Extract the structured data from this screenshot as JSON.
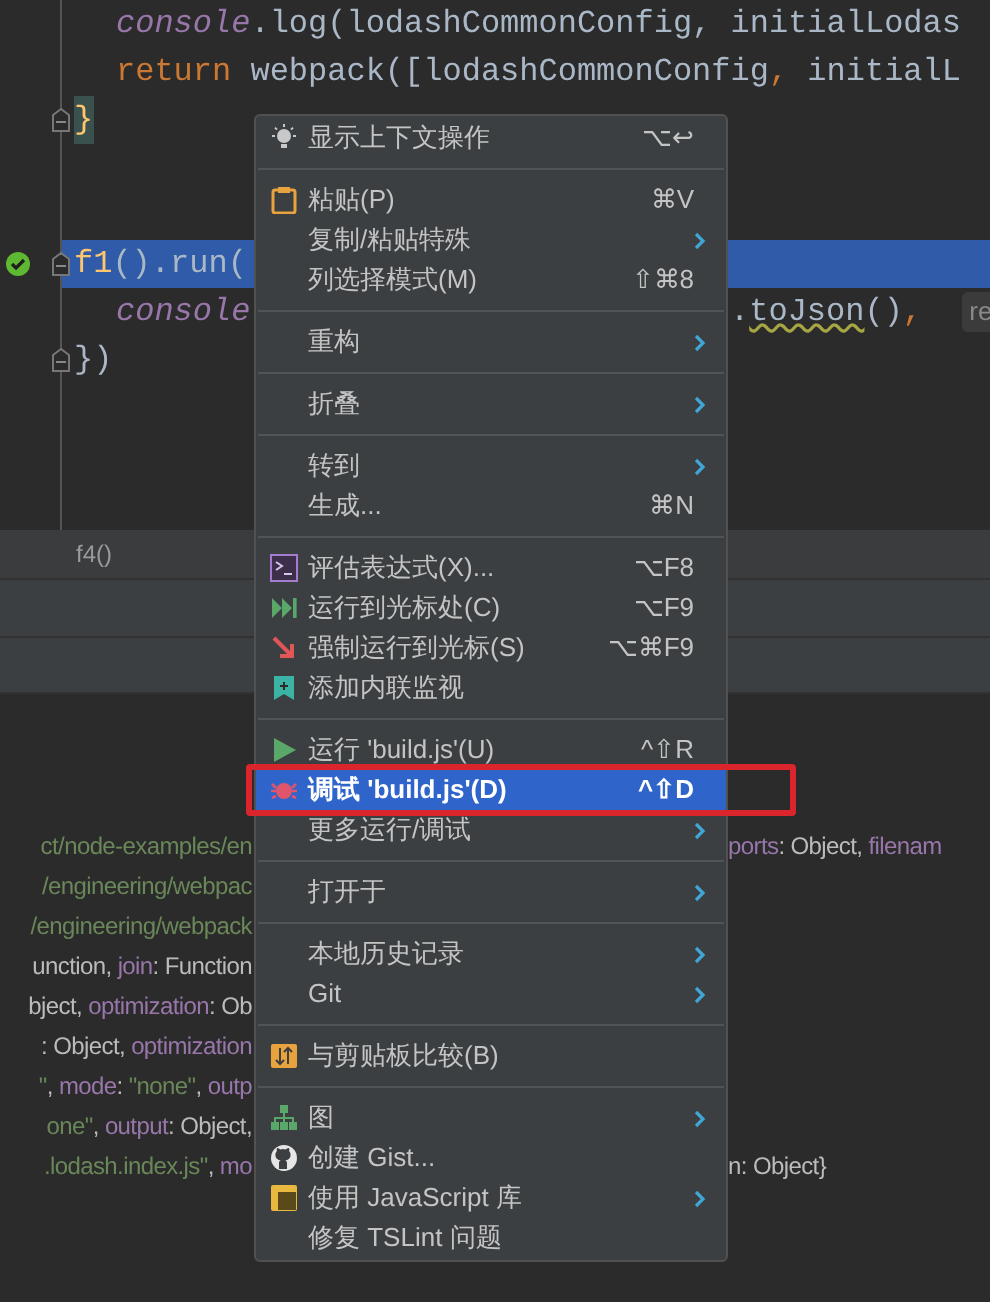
{
  "editor": {
    "lines": [
      {
        "kind": "code",
        "left": [
          {
            "text": "console",
            "kind": "field"
          },
          {
            "text": ".log(lodashCommonConfig, initialLodas",
            "kind": "plain"
          }
        ],
        "indented": true,
        "highlighted": false
      },
      {
        "kind": "code",
        "left": [
          {
            "text": "return ",
            "kind": "keyword"
          },
          {
            "text": "webpack([lodashCommonConfig",
            "kind": "plain"
          },
          {
            "text": ", ",
            "kind": "keyword"
          },
          {
            "text": "initialL",
            "kind": "plain"
          }
        ],
        "indented": true,
        "highlighted": false
      },
      {
        "kind": "code",
        "left": [
          {
            "text": "}",
            "kind": "brace"
          }
        ],
        "gutter": [
          {
            "kind": "fold"
          }
        ],
        "indented": false,
        "highlighted": false
      },
      {
        "kind": "blank"
      },
      {
        "kind": "blank"
      },
      {
        "kind": "code",
        "left": [
          {
            "text": "f1",
            "kind": "function"
          },
          {
            "text": "().run(",
            "kind": "plain"
          }
        ],
        "gutter": [
          {
            "kind": "check"
          },
          {
            "kind": "fold"
          }
        ],
        "indented": false,
        "highlighted": true
      },
      {
        "kind": "code",
        "left": [
          {
            "text": "console",
            "kind": "field"
          }
        ],
        "right": [
          {
            "text": ".",
            "kind": "plain"
          },
          {
            "text": "toJson",
            "kind": "warning"
          },
          {
            "text": "()",
            "kind": "plain"
          },
          {
            "text": ", ",
            "kind": "keyword"
          },
          {
            "text": "re",
            "kind": "hint"
          }
        ],
        "indented": true,
        "highlighted": false
      },
      {
        "kind": "code",
        "left": [
          {
            "text": "})",
            "kind": "plain"
          }
        ],
        "gutter": [
          {
            "kind": "fold"
          }
        ],
        "indented": false,
        "highlighted": false
      }
    ]
  },
  "breadcrumb": "f4()",
  "console_lines": [
    {
      "left": [
        {
          "text": "ct/node-examples/en",
          "kind": "string"
        }
      ],
      "right": [
        {
          "text": "ports",
          "kind": "key"
        },
        {
          "text": ": Object, ",
          "kind": "plain"
        },
        {
          "text": "filenam",
          "kind": "key"
        }
      ]
    },
    {
      "left": [
        {
          "text": "/engineering/webpac",
          "kind": "string"
        }
      ]
    },
    {
      "left": [
        {
          "text": "/engineering/webpack",
          "kind": "string"
        }
      ]
    },
    {
      "left": [
        {
          "text": "unction, ",
          "kind": "plain"
        },
        {
          "text": "join",
          "kind": "key"
        },
        {
          "text": ": Function",
          "kind": "plain"
        }
      ]
    },
    {
      "left": [
        {
          "text": "bject, ",
          "kind": "plain"
        },
        {
          "text": "optimization",
          "kind": "key"
        },
        {
          "text": ": Ob",
          "kind": "plain"
        }
      ]
    },
    {
      "left": [
        {
          "text": ": Object, ",
          "kind": "plain"
        },
        {
          "text": "optimization",
          "kind": "key"
        }
      ]
    },
    {
      "left": [
        {
          "text": "\"",
          "kind": "string"
        },
        {
          "text": ", ",
          "kind": "plain"
        },
        {
          "text": "mode",
          "kind": "key"
        },
        {
          "text": ": ",
          "kind": "plain"
        },
        {
          "text": "\"none\"",
          "kind": "string"
        },
        {
          "text": ", ",
          "kind": "plain"
        },
        {
          "text": "outp",
          "kind": "key"
        }
      ]
    },
    {
      "left": [
        {
          "text": "one\"",
          "kind": "string"
        },
        {
          "text": ", ",
          "kind": "plain"
        },
        {
          "text": "output",
          "kind": "key"
        },
        {
          "text": ": Object,",
          "kind": "plain"
        }
      ]
    },
    {
      "left": [
        {
          "text": ".lodash.index.js\"",
          "kind": "string"
        },
        {
          "text": ", ",
          "kind": "plain"
        },
        {
          "text": "mo",
          "kind": "key"
        }
      ],
      "right": [
        {
          "text": "n: Object}",
          "kind": "plain"
        }
      ]
    }
  ],
  "context_menu": {
    "groups": [
      [
        {
          "label": "显示上下文操作",
          "shortcut": "⌥↩",
          "submenu": false,
          "selected": false,
          "outlined": false
        }
      ],
      [
        {
          "label": "粘贴(P)",
          "shortcut": "⌘V",
          "submenu": false,
          "selected": false,
          "outlined": false
        },
        {
          "label": "复制/粘贴特殊",
          "submenu": true,
          "selected": false,
          "outlined": false
        },
        {
          "label": "列选择模式(M)",
          "shortcut": "⇧⌘8",
          "submenu": false,
          "selected": false,
          "outlined": false
        }
      ],
      [
        {
          "label": "重构",
          "submenu": true,
          "selected": false,
          "outlined": false
        }
      ],
      [
        {
          "label": "折叠",
          "submenu": true,
          "selected": false,
          "outlined": false
        }
      ],
      [
        {
          "label": "转到",
          "submenu": true,
          "selected": false,
          "outlined": false
        },
        {
          "label": "生成...",
          "shortcut": "⌘N",
          "submenu": false,
          "selected": false,
          "outlined": false
        }
      ],
      [
        {
          "label": "评估表达式(X)...",
          "shortcut": "⌥F8",
          "submenu": false,
          "selected": false,
          "outlined": false
        },
        {
          "label": "运行到光标处(C)",
          "shortcut": "⌥F9",
          "submenu": false,
          "selected": false,
          "outlined": false
        },
        {
          "label": "强制运行到光标(S)",
          "shortcut": "⌥⌘F9",
          "submenu": false,
          "selected": false,
          "outlined": false
        },
        {
          "label": "添加内联监视",
          "submenu": false,
          "selected": false,
          "outlined": false
        }
      ],
      [
        {
          "label": "运行 'build.js'(U)",
          "shortcut": "^⇧R",
          "submenu": false,
          "selected": false,
          "outlined": false
        },
        {
          "label": "调试 'build.js'(D)",
          "shortcut": "^⇧D",
          "submenu": false,
          "selected": true,
          "outlined": true
        },
        {
          "label": "更多运行/调试",
          "submenu": true,
          "selected": false,
          "outlined": false
        }
      ],
      [
        {
          "label": "打开于",
          "submenu": true,
          "selected": false,
          "outlined": false
        }
      ],
      [
        {
          "label": "本地历史记录",
          "submenu": true,
          "selected": false,
          "outlined": false
        },
        {
          "label": "Git",
          "submenu": true,
          "selected": false,
          "outlined": false
        }
      ],
      [
        {
          "label": "与剪贴板比较(B)",
          "submenu": false,
          "selected": false,
          "outlined": false
        }
      ],
      [
        {
          "label": "图",
          "submenu": true,
          "selected": false,
          "outlined": false
        },
        {
          "label": "创建 Gist...",
          "submenu": false,
          "selected": false,
          "outlined": false
        },
        {
          "label": "使用 JavaScript 库",
          "submenu": true,
          "selected": false,
          "outlined": false
        },
        {
          "label": "修复 TSLint 问题",
          "submenu": false,
          "selected": false,
          "outlined": false
        }
      ]
    ]
  }
}
